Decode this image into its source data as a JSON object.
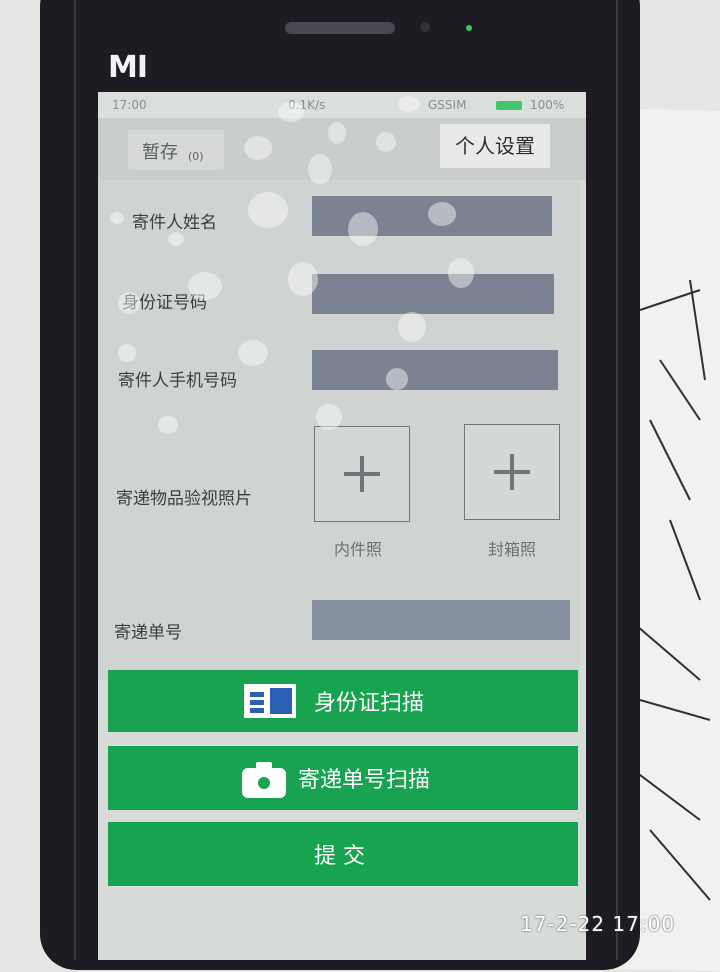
{
  "device": {
    "brand_logo": "MI"
  },
  "statusbar": {
    "time": "17:00",
    "network_speed": "0.1K/s",
    "sim": "GSSIM",
    "battery": "100%"
  },
  "topbar": {
    "storage_label": "暂存",
    "storage_count": "(0)",
    "settings_button": "个人设置"
  },
  "form": {
    "sender_name_label": "寄件人姓名",
    "id_number_label": "身份证号码",
    "phone_label": "寄件人手机号码",
    "photo_label": "寄递物品验视照片",
    "photo_inner_caption": "内件照",
    "photo_box_caption": "封箱照",
    "tracking_label": "寄递单号",
    "sender_name_value": "",
    "id_number_value": "",
    "phone_value": "",
    "tracking_value": ""
  },
  "actions": {
    "id_scan": "身份证扫描",
    "tracking_scan": "寄递单号扫描",
    "submit": "提 交"
  },
  "photo_timestamp": "17-2-22 17:00",
  "colors": {
    "primary_green": "#17a34f",
    "input_fill": "#7b8393"
  },
  "icons": {
    "id_scan": "id-card-icon",
    "tracking_scan": "camera-icon",
    "add_photo": "plus-icon"
  }
}
